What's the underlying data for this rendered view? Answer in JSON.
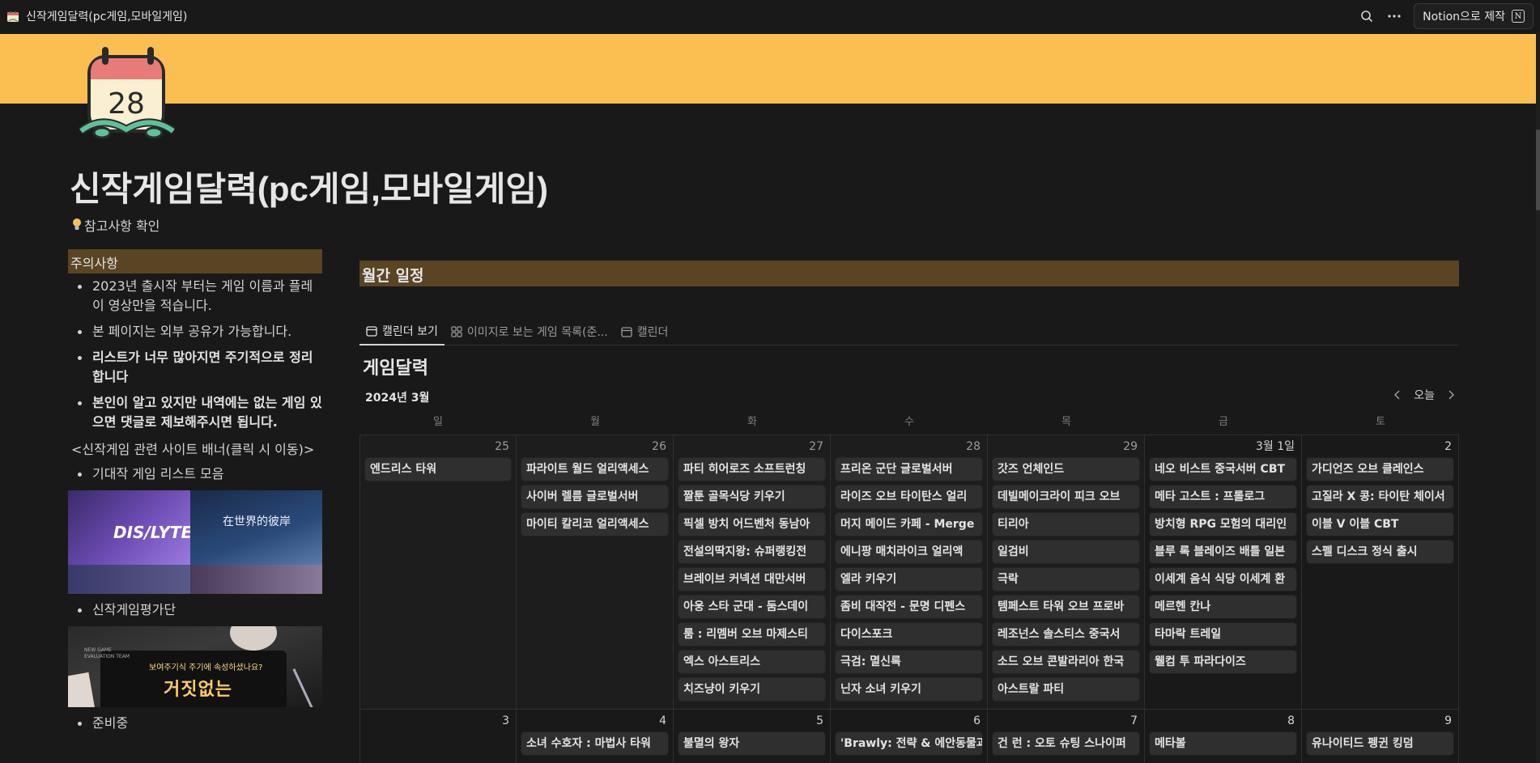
{
  "topbar": {
    "page_name": "신작게임달력(pc게임,모바일게임)",
    "notion_button": "Notion으로 제작",
    "notion_letter": "N",
    "icons": [
      "search-icon",
      "more-icon"
    ]
  },
  "page": {
    "title": "신작게임달력(pc게임,모바일게임)",
    "subtitle": "참고사항 확인",
    "calendar_icon_day": "28"
  },
  "notice": {
    "heading": "주의사항",
    "items": [
      {
        "text": "2023년 출시작 부터는 게임 이름과 플레이 영상만을 적습니다."
      },
      {
        "text": "본 페이지는 외부 공유가 가능합니다."
      },
      {
        "text": "리스트가 너무 많아지면 주기적으로 정리합니다"
      },
      {
        "text": "본인이 알고 있지만 내역에는 없는 게임 있으면 댓글로 제보해주시면 됩니다."
      }
    ],
    "banner_label": "<신작게임 관련 사이트 배너(클릭 시 이동)>",
    "link1": "기대작 게임 리스트 모음",
    "banner_text_dislyte": "DIS/LYTE",
    "banner_text_cn": "在世界的彼岸",
    "link2": "신작게임평가단",
    "eval_team_label": "NEW GAME\nEVALUATION TEAM",
    "eval_question": "보여주기식 주기에 속성하셨나요?",
    "eval_big": "거짓없는",
    "link3": "준비중"
  },
  "section": {
    "heading": "월간 일정",
    "tabs": [
      {
        "label": "캘린더 보기",
        "active": true
      },
      {
        "label": "이미지로 보는 게임 목록(준...",
        "active": false
      },
      {
        "label": "캘린더",
        "active": false
      }
    ]
  },
  "calendar": {
    "title": "게임달력",
    "month": "2024년 3월",
    "today_label": "오늘",
    "weekdays": [
      "일",
      "월",
      "화",
      "수",
      "목",
      "금",
      "토"
    ],
    "week1": [
      {
        "day": "25",
        "events": [
          "엔드리스 타워"
        ]
      },
      {
        "day": "26",
        "events": [
          "파라이트 월드 얼리액세스",
          "사이버 렐름 글로벌서버",
          "마이티 칼리코 얼리액세스"
        ]
      },
      {
        "day": "27",
        "events": [
          "파티 히어로즈 소프트런칭",
          "짤툰 골목식당 키우기",
          "픽셀 방치 어드벤처 동남아",
          "전설의딱지왕: 슈퍼랭킹전",
          "브레이브 커넥션 대만서버",
          "아웅 스타 군대 - 둠스데이",
          "룸 : 리멤버 오브 마제스티",
          "엑스 아스트리스",
          "치즈냥이 키우기"
        ]
      },
      {
        "day": "28",
        "events": [
          "프리온 군단 글로벌서버",
          "라이즈 오브 타이탄스 얼리",
          "머지 메이드 카페 - Merge",
          "에니팡 매치라이크 얼리액",
          "엘라 키우기",
          "좀비 대작전 - 문명 디펜스",
          "다이스포크",
          "극검: 멸신록",
          "닌자 소녀 키우기"
        ]
      },
      {
        "day": "29",
        "events": [
          "갓즈 언체인드",
          "데빌메이크라이 피크 오브",
          "티리아",
          "일검비",
          "극락",
          "템페스트 타워 오브 프로바",
          "레조넌스 솔스티스 중국서",
          "소드 오브 콘발라리아 한국",
          "아스트랄 파티"
        ]
      },
      {
        "day": "3월 1일",
        "events": [
          "네오 비스트 중국서버 CBT",
          "메타 고스트 : 프롤로그",
          "방치형 RPG 모험의 대리인",
          "블루 록 블레이즈 배틀 일본",
          "이세계 음식 식당 이세계 환",
          "메르헨 칸나",
          "타마락 트레일",
          "웰컴 투 파라다이즈"
        ]
      },
      {
        "day": "2",
        "events": [
          "가디언즈 오브 클레인스",
          "고질라 X 콩: 타이탄 체이서",
          "이블 V 이블 CBT",
          "스펠 디스크 정식 출시"
        ]
      }
    ],
    "week2": [
      {
        "day": "3",
        "events": []
      },
      {
        "day": "4",
        "events": [
          "소녀 수호자 : 마법사 타워"
        ]
      },
      {
        "day": "5",
        "events": [
          "불멸의 왕자"
        ]
      },
      {
        "day": "6",
        "events": [
          "'Brawly: 전략 & 에안동물과"
        ]
      },
      {
        "day": "7",
        "events": [
          "건 런 : 오토 슈팅 스나이퍼"
        ]
      },
      {
        "day": "8",
        "events": [
          "메타볼"
        ]
      },
      {
        "day": "9",
        "events": [
          "유나이티드 펭귄 킹덤"
        ]
      }
    ]
  },
  "colors": {
    "cover": "#fbbf51",
    "callout_bg": "#5a4424",
    "event_bg": "#2f2f2f",
    "background": "#191919"
  }
}
